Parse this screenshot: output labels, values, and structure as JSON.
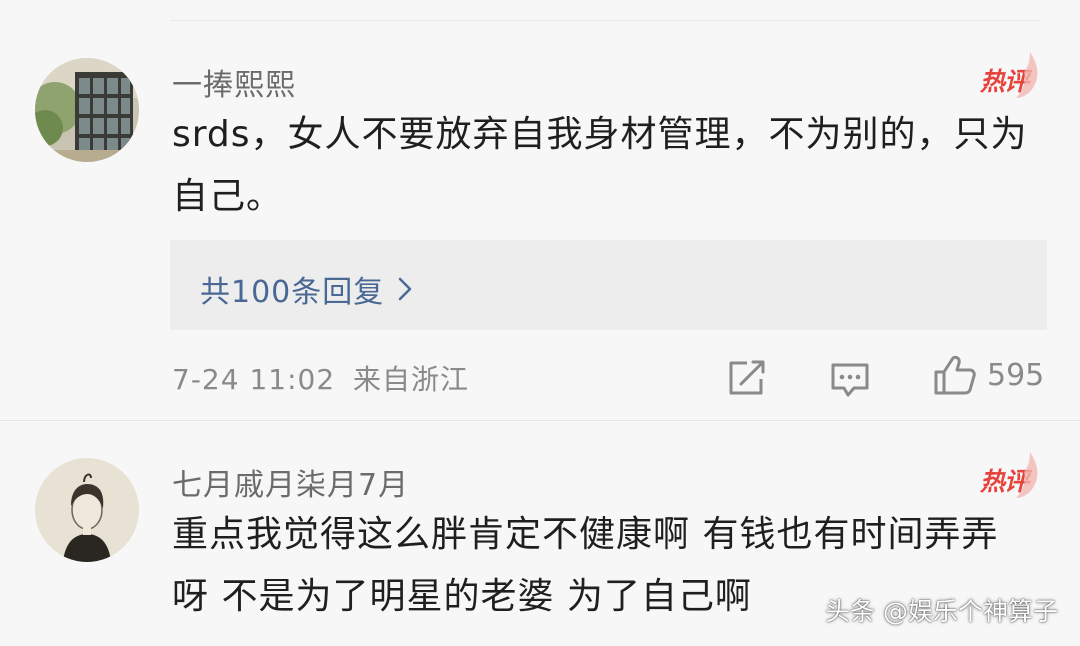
{
  "comments": [
    {
      "username": "一捧熙熙",
      "badge": "热评",
      "text": "srds，女人不要放弃自我身材管理，不为别的，只为自己。",
      "replies_label": "共100条回复",
      "timestamp": "7-24 11:02",
      "location": "来自浙江",
      "likes": "595",
      "avatar_icon": "window-photo-avatar"
    },
    {
      "username": "七月戚月柒月7月",
      "badge": "热评",
      "text": "重点我觉得这么胖肯定不健康啊 有钱也有时间弄弄呀 不是为了明星的老婆 为了自己啊",
      "avatar_icon": "sketch-portrait-avatar"
    }
  ],
  "watermark": "头条 @娱乐个神算子",
  "colors": {
    "badge": "#e5433b",
    "link": "#4a6894",
    "meta": "#8a8a8a"
  }
}
